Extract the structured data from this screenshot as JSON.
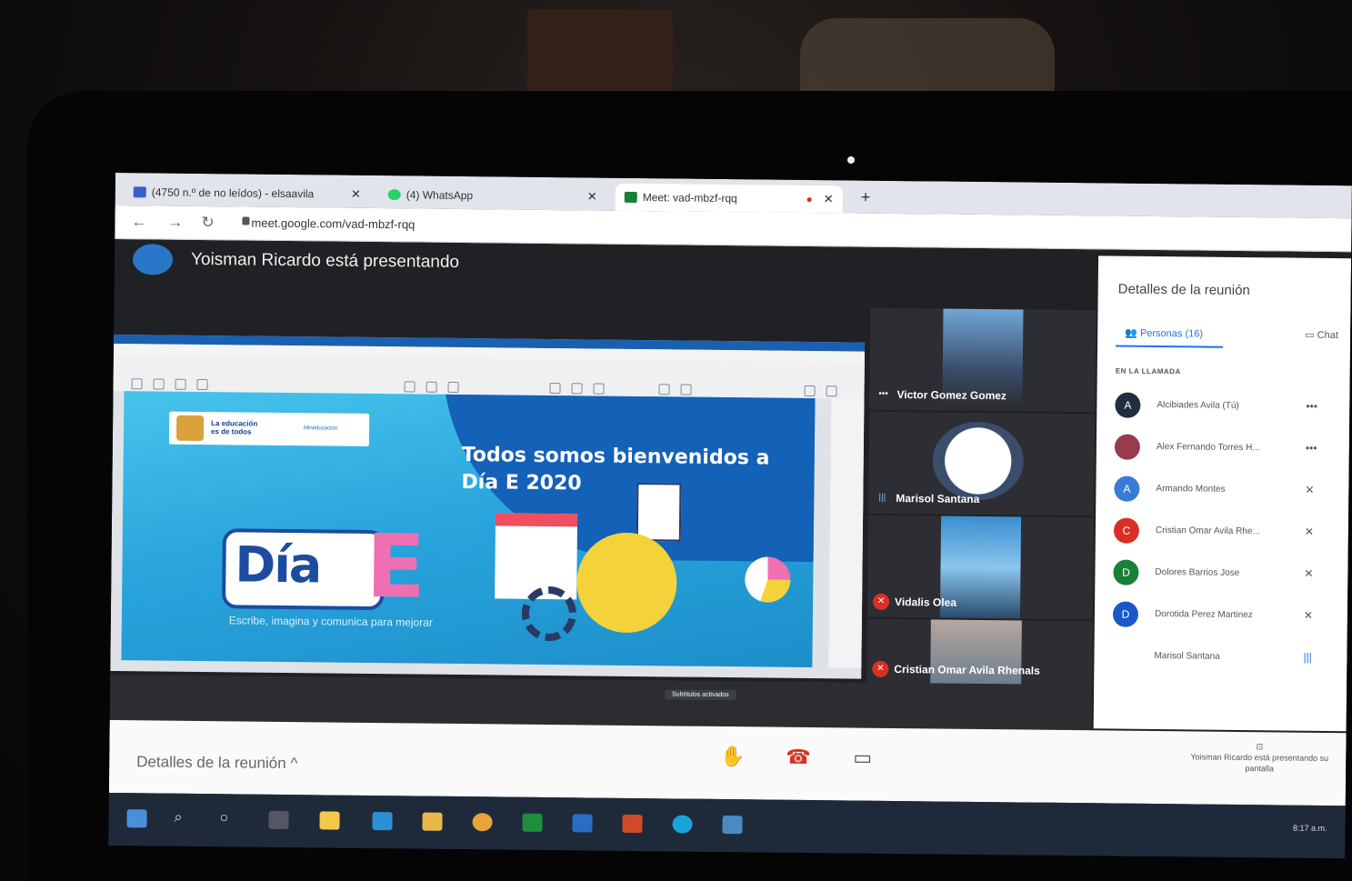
{
  "browser": {
    "tabs": [
      {
        "label": "(4750 n.º de no leídos) - elsaavila",
        "active": false
      },
      {
        "label": "(4) WhatsApp",
        "active": false
      },
      {
        "label": "Meet: vad-mbzf-rqq",
        "active": true
      }
    ],
    "new_tab": "+",
    "url": "meet.google.com/vad-mbzf-rqq"
  },
  "meet": {
    "presenting_text": "Yoisman Ricardo está presentando",
    "slide": {
      "logo_line1": "La educación",
      "logo_line2": "es de todos",
      "logo_ministry": "Mineducación",
      "title_line1": "Todos somos bienvenidos a",
      "title_line2": "Día E 2020",
      "dia": "Día",
      "e": "E",
      "subtitle": "Escribe, imagina y comunica para mejorar"
    },
    "participants_tiles": [
      {
        "name": "Victor Gomez Gomez",
        "indicator": "•••"
      },
      {
        "name": "Marisol Santana",
        "indicator": "|||"
      },
      {
        "name": "Vidalis Olea",
        "indicator": "🎙"
      },
      {
        "name": "Cristian Omar Avila Rhenals",
        "indicator": "🎙"
      }
    ],
    "panel": {
      "title": "Detalles de la reunión",
      "tab_people": "Personas (16)",
      "tab_chat": "Chat",
      "section": "EN LA LLAMADA",
      "people": [
        {
          "initial": "A",
          "name": "Alcibiades Avila (Tú)",
          "status": "•••",
          "color": "#1f2f3f"
        },
        {
          "initial": "",
          "name": "Alex Fernando Torres H...",
          "status": "•••",
          "color": "#9a3b4a"
        },
        {
          "initial": "A",
          "name": "Armando Montes",
          "status": "✕",
          "color": "#3a7bd5"
        },
        {
          "initial": "C",
          "name": "Cristian Omar Avila Rhe...",
          "status": "✕",
          "color": "#d93025"
        },
        {
          "initial": "D",
          "name": "Dolores Barrios Jose",
          "status": "✕",
          "color": "#188038"
        },
        {
          "initial": "D",
          "name": "Dorotida Perez Martinez",
          "status": "✕",
          "color": "#1a57c8"
        },
        {
          "initial": "",
          "name": "Marisol Santana",
          "status": "|||",
          "color": "#555555"
        }
      ]
    },
    "bottom": {
      "details_label": "Detalles de la reunión",
      "presenting_note": "Yoisman Ricardo está presentando su pantalla",
      "captions_label": "Subtítulos activados"
    }
  },
  "taskbar": {
    "clock": "8:17 a.m."
  }
}
